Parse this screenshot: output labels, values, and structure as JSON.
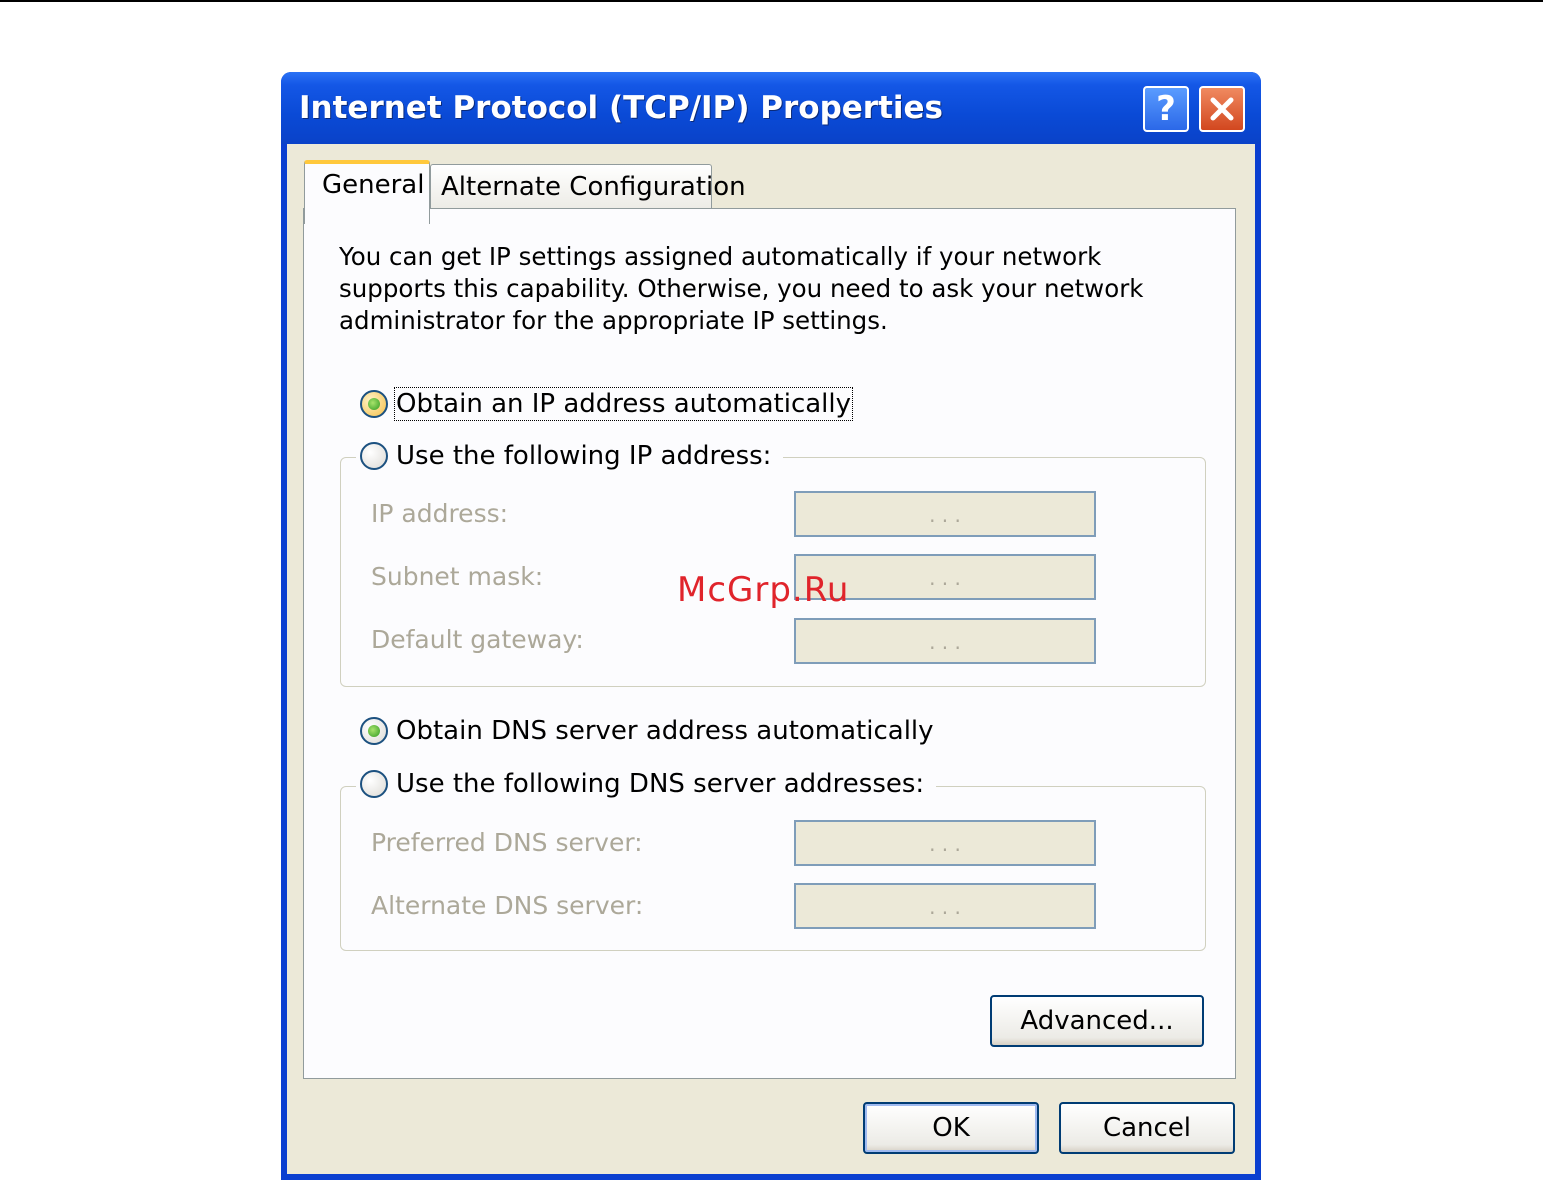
{
  "window": {
    "title": "Internet Protocol (TCP/IP) Properties",
    "help_label": "?"
  },
  "tabs": [
    {
      "label": "General",
      "selected": true
    },
    {
      "label": "Alternate Configuration",
      "selected": false
    }
  ],
  "general": {
    "intro": "You can get IP settings assigned automatically if your network supports this capability. Otherwise, you need to ask your network administrator for the appropriate IP settings.",
    "ip_mode": {
      "auto_label": "Obtain an IP address automatically",
      "manual_label": "Use the following IP address:",
      "selected": "auto"
    },
    "ip_fields": [
      {
        "label": "IP address:",
        "value": ". . ."
      },
      {
        "label": "Subnet mask:",
        "value": ". . ."
      },
      {
        "label": "Default gateway:",
        "value": ". . ."
      }
    ],
    "dns_mode": {
      "auto_label": "Obtain DNS server address automatically",
      "manual_label": "Use the following DNS server addresses:",
      "selected": "auto"
    },
    "dns_fields": [
      {
        "label": "Preferred DNS server:",
        "value": ". . ."
      },
      {
        "label": "Alternate DNS server:",
        "value": ". . ."
      }
    ],
    "advanced_label": "Advanced..."
  },
  "footer": {
    "ok_label": "OK",
    "cancel_label": "Cancel"
  },
  "watermark": "McGrp.Ru",
  "colors": {
    "titlebar": "#0a4ad6",
    "dialog_bg": "#ece9d8",
    "panel_bg": "#fcfcfe",
    "disabled_text": "#aca899",
    "tab_highlight": "#ffc83c",
    "watermark": "#e0242b"
  }
}
